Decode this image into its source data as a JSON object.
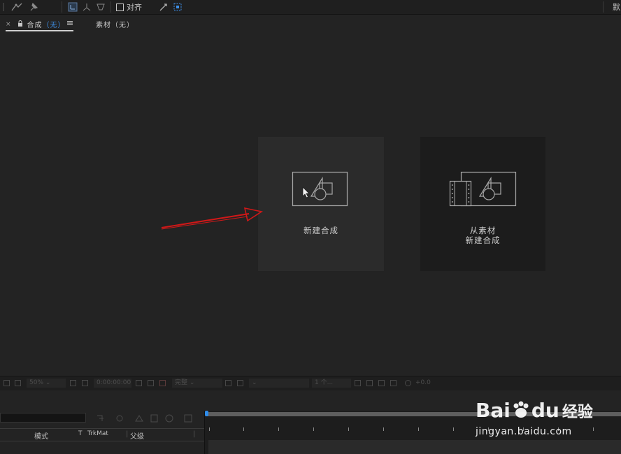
{
  "toolbar": {
    "snap_label": "对齐",
    "right_fragment": "默"
  },
  "tabs": [
    {
      "prefix": "合成",
      "paren_open": "（",
      "name": "无",
      "paren_close": "）"
    },
    {
      "label": "素材（无）"
    }
  ],
  "cards": {
    "new_composition": {
      "label": "新建合成"
    },
    "from_footage": {
      "line1": "从素材",
      "line2": "新建合成"
    }
  },
  "viewer_bar": {
    "zoom": "50%",
    "timecode": "0:00:00:00",
    "resolution": "完整",
    "view_count": "1 个...",
    "exposure": "+0.0"
  },
  "timeline": {
    "columns": {
      "mode": "模式",
      "t": "T",
      "trkmat": "TrkMat",
      "parent": "父级"
    }
  },
  "watermark": {
    "logo": "Bai",
    "logo_suffix": "du",
    "logo_cn": "经验",
    "url": "jingyan.baidu.com"
  },
  "colors": {
    "accent_blue": "#3d8fe8",
    "arrow_red": "#d01818",
    "panel_bg": "#232323"
  }
}
